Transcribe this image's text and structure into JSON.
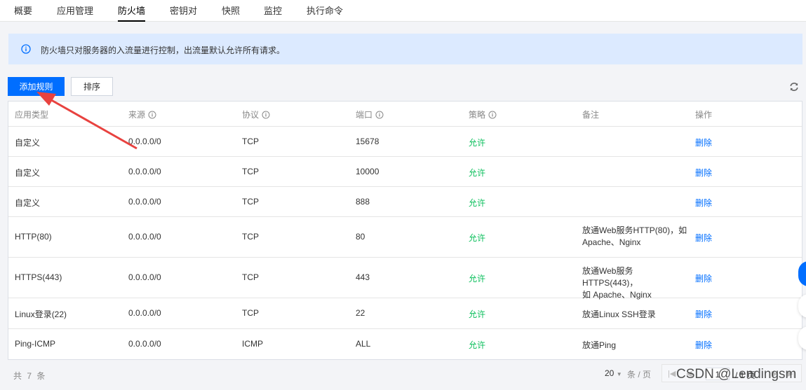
{
  "tabs": [
    {
      "label": "概要"
    },
    {
      "label": "应用管理"
    },
    {
      "label": "防火墙",
      "active": true
    },
    {
      "label": "密钥对"
    },
    {
      "label": "快照"
    },
    {
      "label": "监控"
    },
    {
      "label": "执行命令"
    }
  ],
  "notice": {
    "text": "防火墙只对服务器的入流量进行控制，出流量默认允许所有请求。",
    "icon": "info-icon"
  },
  "toolbar": {
    "add_label": "添加规则",
    "sort_label": "排序",
    "refresh_icon": "refresh-icon"
  },
  "table": {
    "headers": [
      "应用类型",
      "来源",
      "协议",
      "端口",
      "策略",
      "备注",
      "操作"
    ],
    "rows": [
      {
        "type": "自定义",
        "source": "0.0.0.0/0",
        "protocol": "TCP",
        "port": "15678",
        "policy": "允许",
        "note_line1": "",
        "note_line2": "",
        "action": "删除"
      },
      {
        "type": "自定义",
        "source": "0.0.0.0/0",
        "protocol": "TCP",
        "port": "10000",
        "policy": "允许",
        "note_line1": "",
        "note_line2": "",
        "action": "删除"
      },
      {
        "type": "自定义",
        "source": "0.0.0.0/0",
        "protocol": "TCP",
        "port": "888",
        "policy": "允许",
        "note_line1": "",
        "note_line2": "",
        "action": "删除"
      },
      {
        "type": "HTTP(80)",
        "source": "0.0.0.0/0",
        "protocol": "TCP",
        "port": "80",
        "policy": "允许",
        "note_line1": "放通Web服务HTTP(80)，如",
        "note_line2": "Apache、Nginx",
        "action": "删除"
      },
      {
        "type": "HTTPS(443)",
        "source": "0.0.0.0/0",
        "protocol": "TCP",
        "port": "443",
        "policy": "允许",
        "note_line1": "放通Web服务HTTPS(443)，",
        "note_line2": "如 Apache、Nginx",
        "action": "删除"
      },
      {
        "type": "Linux登录(22)",
        "source": "0.0.0.0/0",
        "protocol": "TCP",
        "port": "22",
        "policy": "允许",
        "note_line1": "放通Linux SSH登录",
        "note_line2": "",
        "action": "删除"
      },
      {
        "type": "Ping-ICMP",
        "source": "0.0.0.0/0",
        "protocol": "ICMP",
        "port": "ALL",
        "policy": "允许",
        "note_line1": "放通Ping",
        "note_line2": "",
        "action": "删除"
      }
    ]
  },
  "footer": {
    "total": "共 7 条",
    "page_size": "20",
    "per_page": "条 / 页",
    "page_current": "1",
    "page_total": "/ 1 页"
  },
  "watermark": "CSDN @Lendingsm",
  "colors": {
    "primary": "#006eff",
    "allow": "#0abf5b",
    "notice_bg": "#dceaff",
    "arrow": "#e8423f"
  }
}
